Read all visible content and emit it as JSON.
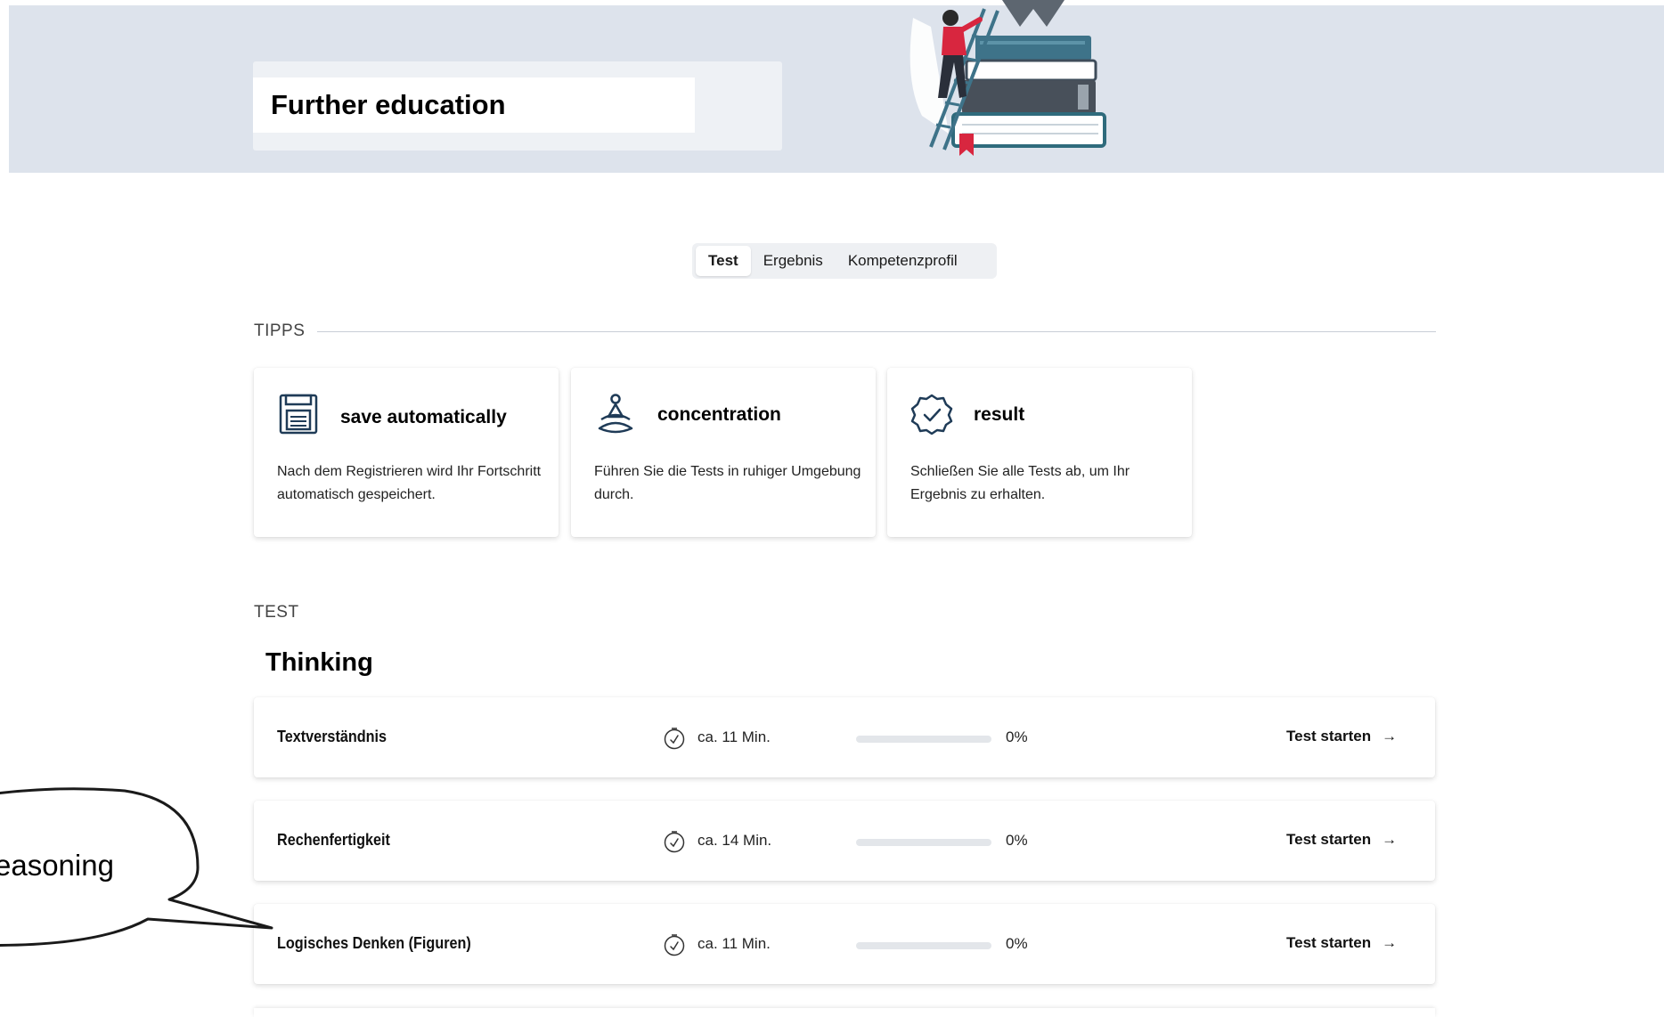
{
  "header": {
    "title": "Further education",
    "illustration": "woman-climbing-ladder-on-books-illustration"
  },
  "tabs": [
    {
      "label": "Test",
      "active": true
    },
    {
      "label": "Ergebnis",
      "active": false
    },
    {
      "label": "Kompetenzprofil",
      "active": false
    }
  ],
  "tips": {
    "heading": "TIPPS",
    "cards": [
      {
        "icon": "floppy-disk-icon",
        "title": "save automatically",
        "text": "Nach dem Registrieren wird Ihr Fortschritt automatisch gespeichert."
      },
      {
        "icon": "meditation-icon",
        "title": "concentration",
        "text": "Führen Sie die Tests in ruhiger Umgebung durch."
      },
      {
        "icon": "verified-badge-icon",
        "title": "result",
        "text": "Schließen Sie alle Tests ab, um Ihr Ergebnis zu erhalten."
      }
    ]
  },
  "test_section": {
    "heading": "TEST",
    "group_title": "Thinking",
    "start_label": "Test starten",
    "start_arrow": "→",
    "tests": [
      {
        "name": "Textverständnis",
        "duration": "ca. 11 Min.",
        "progress_percent": 0,
        "progress_label": "0%"
      },
      {
        "name": "Rechenfertigkeit",
        "duration": "ca. 14 Min.",
        "progress_percent": 0,
        "progress_label": "0%"
      },
      {
        "name": "Logisches Denken (Figuren)",
        "duration": "ca. 11 Min.",
        "progress_percent": 0,
        "progress_label": "0%"
      }
    ]
  },
  "annotation": {
    "bubble_text": "reasoning"
  },
  "colors": {
    "hero_background": "#dde3ec",
    "progress_track": "#e3e6ea",
    "card_background": "#ffffff"
  }
}
